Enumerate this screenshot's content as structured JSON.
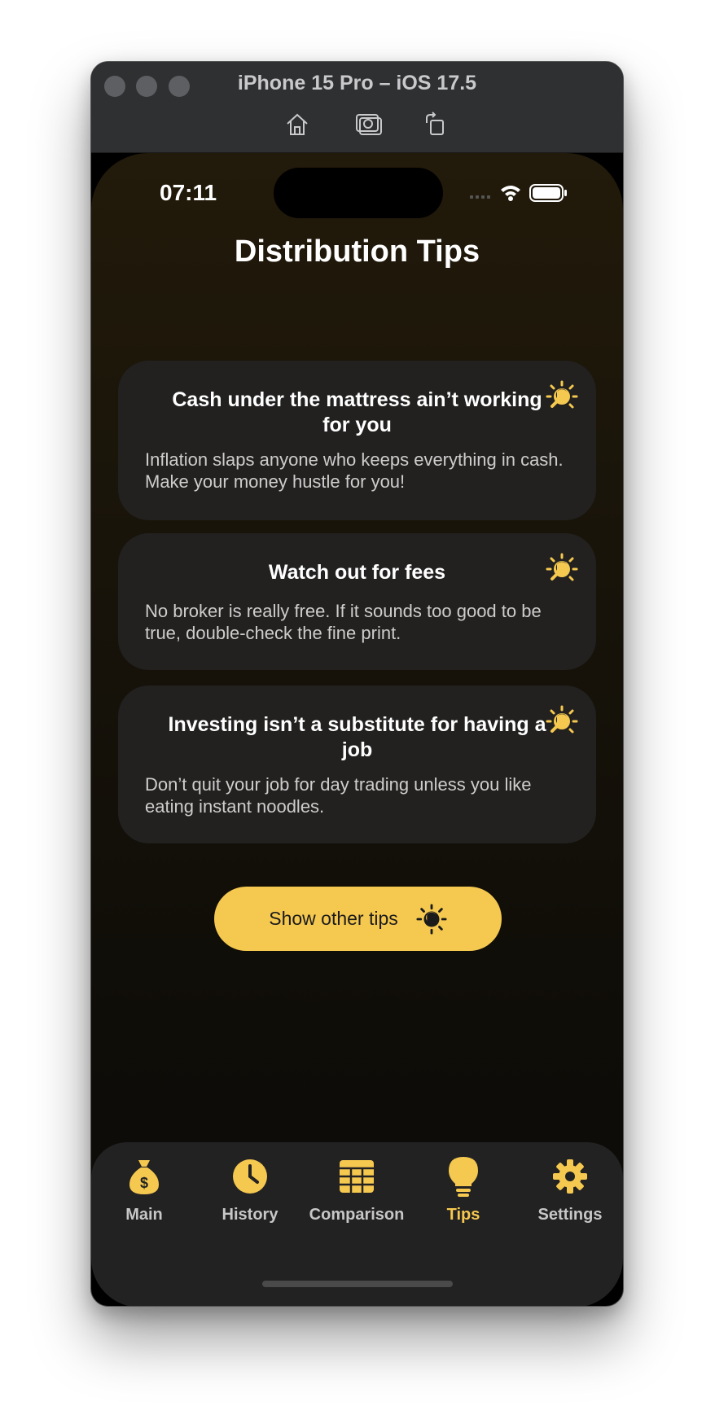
{
  "simulator": {
    "title": "iPhone 15 Pro – iOS 17.5",
    "tools": [
      "home-icon",
      "screenshot-icon",
      "rotate-icon"
    ]
  },
  "status_bar": {
    "time": "07:11"
  },
  "page": {
    "title": "Distribution Tips"
  },
  "tips": [
    {
      "title": "Cash under the mattress ain’t working for you",
      "body": "Inflation slaps anyone who keeps everything in cash. Make your money hustle for you!",
      "icon": "sun-bulb-icon"
    },
    {
      "title": "Watch out for fees",
      "body": "No broker is really free. If it sounds too good to be true, double-check the fine print.",
      "icon": "sun-bulb-icon"
    },
    {
      "title": "Investing isn’t a substitute for having a job",
      "body": "Don’t quit your job for day trading unless you like eating instant noodles.",
      "icon": "sun-bulb-icon"
    }
  ],
  "cta": {
    "label": "Show other tips",
    "icon": "sun-bulb-icon"
  },
  "tabbar": {
    "items": [
      {
        "label": "Main",
        "icon": "money-bag-icon",
        "active": false
      },
      {
        "label": "History",
        "icon": "clock-icon",
        "active": false
      },
      {
        "label": "Comparison",
        "icon": "table-icon",
        "active": false
      },
      {
        "label": "Tips",
        "icon": "lightbulb-icon",
        "active": true
      },
      {
        "label": "Settings",
        "icon": "gear-icon",
        "active": false
      }
    ]
  },
  "colors": {
    "accent": "#f5c84f",
    "card": "#222120",
    "tab_inactive": "#c8c7c7"
  }
}
